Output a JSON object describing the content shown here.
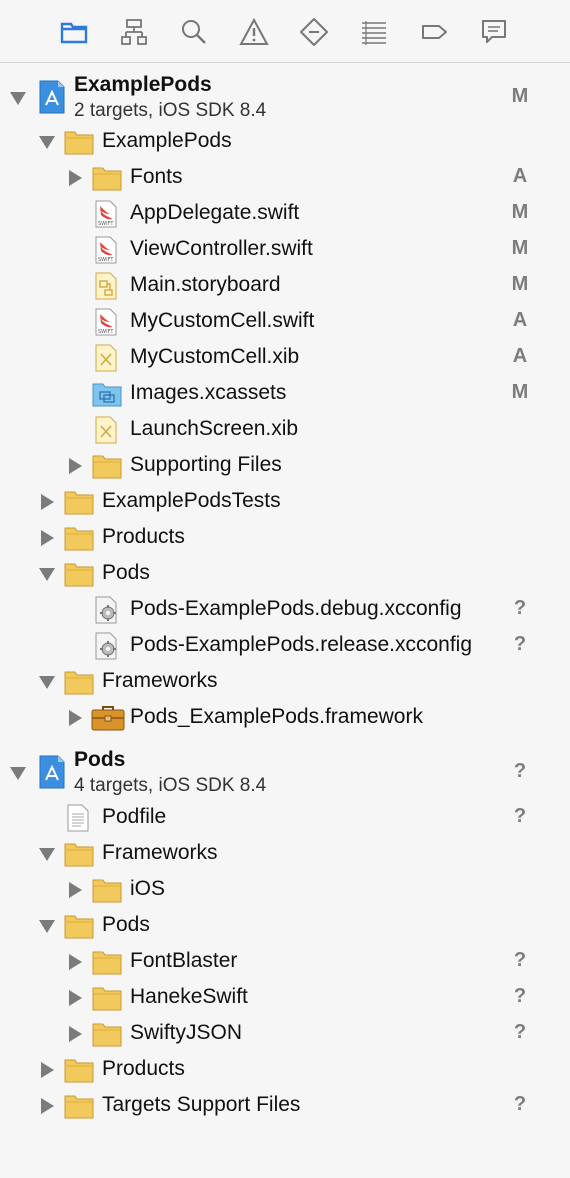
{
  "toolbar": {
    "icons": [
      "folder-icon",
      "hierarchy-icon",
      "search-icon",
      "warning-icon",
      "test-diamond-icon",
      "list-icon",
      "breakpoint-icon",
      "comment-icon"
    ]
  },
  "tree": {
    "project1": {
      "name": "ExamplePods",
      "subtitle": "2 targets, iOS SDK 8.4",
      "status": "M"
    },
    "g_examplepods": {
      "label": "ExamplePods"
    },
    "g_fonts": {
      "label": "Fonts",
      "status": "A"
    },
    "f_appdelegate": {
      "label": "AppDelegate.swift",
      "status": "M"
    },
    "f_viewcontroller": {
      "label": "ViewController.swift",
      "status": "M"
    },
    "f_mainstoryboard": {
      "label": "Main.storyboard",
      "status": "M"
    },
    "f_mycustomcell_swift": {
      "label": "MyCustomCell.swift",
      "status": "A"
    },
    "f_mycustomcell_xib": {
      "label": "MyCustomCell.xib",
      "status": "A"
    },
    "f_images": {
      "label": "Images.xcassets",
      "status": "M"
    },
    "f_launchscreen": {
      "label": "LaunchScreen.xib"
    },
    "g_supporting": {
      "label": "Supporting Files"
    },
    "g_tests": {
      "label": "ExamplePodsTests"
    },
    "g_products1": {
      "label": "Products"
    },
    "g_pods1": {
      "label": "Pods"
    },
    "f_debugxc": {
      "label": "Pods-ExamplePods.debug.xcconfig",
      "status": "?"
    },
    "f_releasexc": {
      "label": "Pods-ExamplePods.release.xcconfig",
      "status": "?"
    },
    "g_frameworks1": {
      "label": "Frameworks"
    },
    "f_podsframework": {
      "label": "Pods_ExamplePods.framework"
    },
    "project2": {
      "name": "Pods",
      "subtitle": "4 targets, iOS SDK 8.4",
      "status": "?"
    },
    "f_podfile": {
      "label": "Podfile",
      "status": "?"
    },
    "g_frameworks2": {
      "label": "Frameworks"
    },
    "g_ios": {
      "label": "iOS"
    },
    "g_pods2": {
      "label": "Pods"
    },
    "g_fontblaster": {
      "label": "FontBlaster",
      "status": "?"
    },
    "g_haneke": {
      "label": "HanekeSwift",
      "status": "?"
    },
    "g_swiftyjson": {
      "label": "SwiftyJSON",
      "status": "?"
    },
    "g_products2": {
      "label": "Products"
    },
    "g_targetsupport": {
      "label": "Targets Support Files",
      "status": "?"
    }
  },
  "colors": {
    "selected_icon": "#2f7bd9",
    "folder": "#f2c95c",
    "status": "#7d7d7d"
  }
}
